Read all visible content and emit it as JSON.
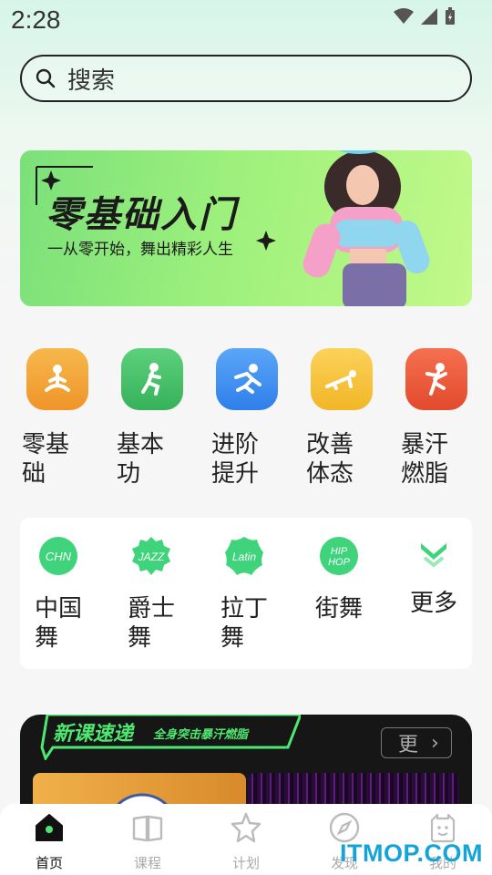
{
  "status": {
    "time": "2:28"
  },
  "search": {
    "placeholder": "搜索"
  },
  "banner": {
    "title": "零基础入门",
    "subtitle": "一从零开始，舞出精彩人生"
  },
  "categories": [
    {
      "label": "零基础",
      "icon": "meditation-icon",
      "color": "#f3a136"
    },
    {
      "label": "基本功",
      "icon": "squat-icon",
      "color": "#45c06a"
    },
    {
      "label": "进阶提升",
      "icon": "running-icon",
      "color": "#3d8ff2"
    },
    {
      "label": "改善体态",
      "icon": "pushup-icon",
      "color": "#f6c43a"
    },
    {
      "label": "暴汗燃脂",
      "icon": "kick-icon",
      "color": "#ef5a3c"
    }
  ],
  "dances": [
    {
      "badge": "CHN",
      "label": "中国舞"
    },
    {
      "badge": "JAZZ",
      "label": "爵士舞"
    },
    {
      "badge": "Latin",
      "label": "拉丁舞"
    },
    {
      "badge": "HIP HOP",
      "label": "街舞"
    },
    {
      "badge": "",
      "label": "更多"
    }
  ],
  "new_courses": {
    "tag_title": "新课速递",
    "tag_sub": "全身突击暴汗燃脂",
    "more_label": "更"
  },
  "tabbar": [
    {
      "label": "首页",
      "icon": "home-icon",
      "active": true
    },
    {
      "label": "课程",
      "icon": "book-icon",
      "active": false
    },
    {
      "label": "计划",
      "icon": "star-icon",
      "active": false
    },
    {
      "label": "发现",
      "icon": "compass-icon",
      "active": false
    },
    {
      "label": "我的",
      "icon": "profile-icon",
      "active": false
    }
  ],
  "watermark": "ITMOP.COM",
  "colors": {
    "accent": "#4de870",
    "dark": "#161616",
    "tab_active": "#111111"
  }
}
